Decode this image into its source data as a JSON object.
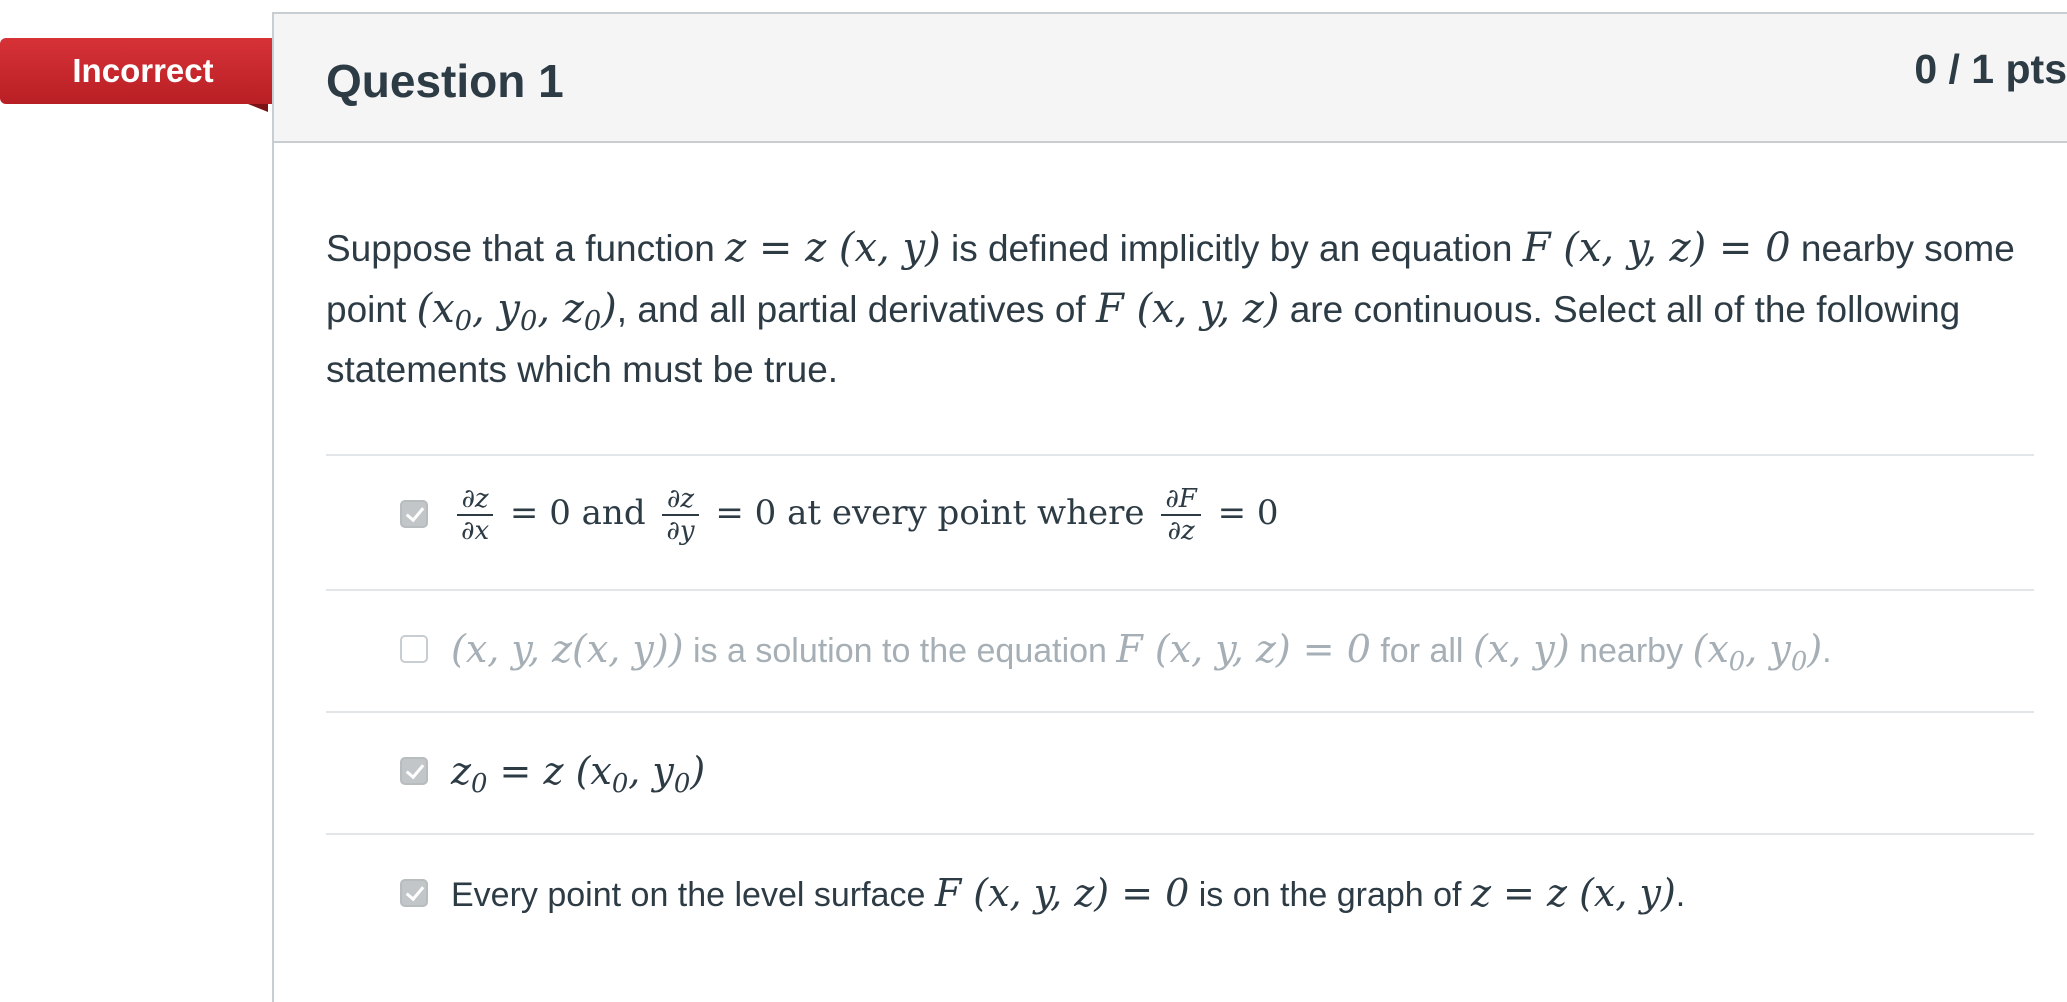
{
  "banner": {
    "label": "Incorrect"
  },
  "question": {
    "title": "Question 1",
    "points": "0 / 1 pts",
    "text": {
      "p1": "Suppose that a function",
      "m1": "z = z (x, y)",
      "p2": "is defined implicitly by an equation",
      "m2": "F (x, y, z) = 0",
      "p3": "nearby some point",
      "m3": "(x0, y0, z0)",
      "p4": ", and all partial derivatives of",
      "m4": "F (x, y, z)",
      "p5": "are continuous. Select all of the following statements which must be true."
    }
  },
  "answers": [
    {
      "checked": true,
      "dimmed": false,
      "frac1_num": "∂z",
      "frac1_den": "∂x",
      "t1": "= 0 and",
      "frac2_num": "∂z",
      "frac2_den": "∂y",
      "t2": "= 0 at every point where",
      "frac3_num": "∂F",
      "frac3_den": "∂z",
      "t3": "= 0"
    },
    {
      "checked": false,
      "dimmed": true,
      "m1": "(x, y, z(x, y))",
      "t1": "is a solution to the equation",
      "m2": "F (x, y, z) = 0",
      "t2": "for all",
      "m3": "(x, y)",
      "t3": "nearby",
      "m4": "(x0, y0)",
      "t4": "."
    },
    {
      "checked": true,
      "dimmed": false,
      "m1": "z0 = z (x0, y0)"
    },
    {
      "checked": true,
      "dimmed": false,
      "t1": "Every point on the level surface",
      "m1": "F (x, y, z) = 0",
      "t2": "is on the graph of",
      "m2": "z = z (x, y)",
      "t3": "."
    }
  ],
  "colors": {
    "banner": "#c8262c",
    "text": "#2d3b45",
    "dimmed_text": "#a5afb5",
    "header_bg": "#f5f5f5",
    "border": "#c7cdd1"
  }
}
